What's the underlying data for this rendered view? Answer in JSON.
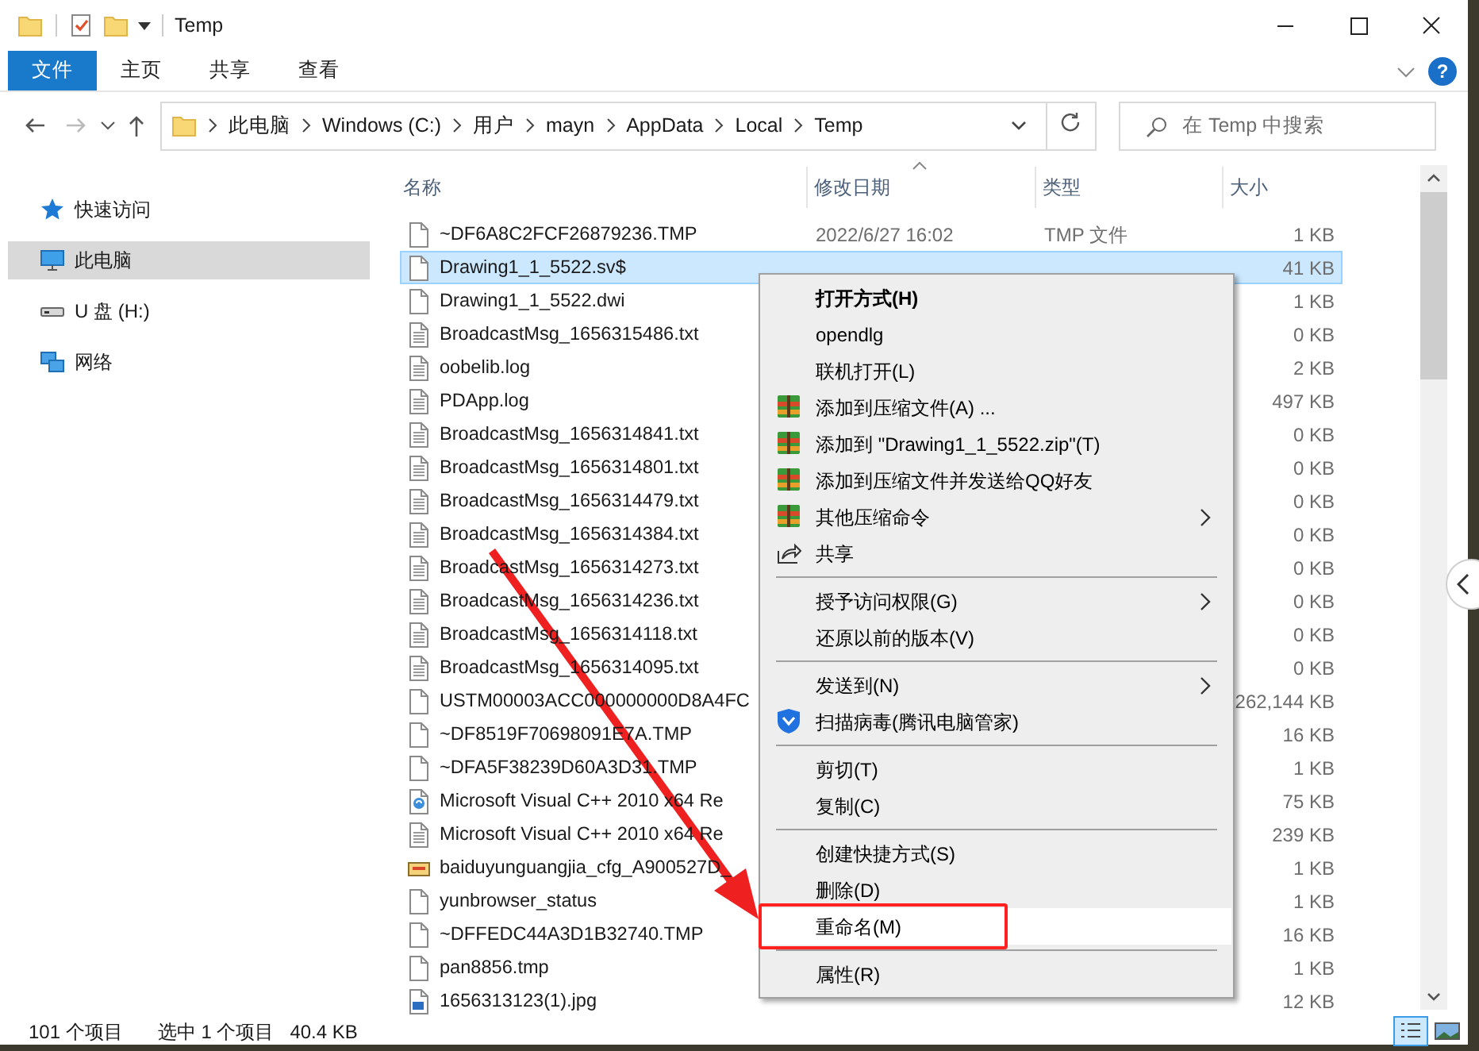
{
  "window": {
    "title": "Temp"
  },
  "ribbon": {
    "tabs": [
      {
        "label": "文件",
        "kind": "file"
      },
      {
        "label": "主页",
        "kind": "tab"
      },
      {
        "label": "共享",
        "kind": "tab"
      },
      {
        "label": "查看",
        "kind": "tab"
      }
    ],
    "help_label": "?"
  },
  "address_bar": {
    "crumbs": [
      "此电脑",
      "Windows (C:)",
      "用户",
      "mayn",
      "AppData",
      "Local",
      "Temp"
    ],
    "search_placeholder": "在 Temp 中搜索"
  },
  "nav_pane": {
    "items": [
      {
        "label": "快速访问",
        "kind": "star",
        "selected": false
      },
      {
        "label": "此电脑",
        "kind": "pc",
        "selected": true
      },
      {
        "label": "U 盘 (H:)",
        "kind": "drive",
        "selected": false
      },
      {
        "label": "网络",
        "kind": "network",
        "selected": false
      }
    ]
  },
  "file_list": {
    "columns": [
      {
        "label": "名称",
        "sorted": false
      },
      {
        "label": "修改日期",
        "sorted": true
      },
      {
        "label": "类型",
        "sorted": false
      },
      {
        "label": "大小",
        "sorted": false
      }
    ],
    "rows": [
      {
        "name": "~DF6A8C2FCF26879236.TMP",
        "date": "2022/6/27 16:02",
        "type": "TMP 文件",
        "size": "1 KB",
        "kind": "blank",
        "selected": false
      },
      {
        "name": "Drawing1_1_5522.sv$",
        "size": "41 KB",
        "kind": "blank",
        "selected": true
      },
      {
        "name": "Drawing1_1_5522.dwi",
        "size": "1 KB",
        "kind": "blank",
        "selected": false
      },
      {
        "name": "BroadcastMsg_1656315486.txt",
        "size": "0 KB",
        "kind": "text",
        "selected": false
      },
      {
        "name": "oobelib.log",
        "size": "2 KB",
        "kind": "text",
        "selected": false
      },
      {
        "name": "PDApp.log",
        "size": "497 KB",
        "kind": "text",
        "selected": false
      },
      {
        "name": "BroadcastMsg_1656314841.txt",
        "size": "0 KB",
        "kind": "text",
        "selected": false
      },
      {
        "name": "BroadcastMsg_1656314801.txt",
        "size": "0 KB",
        "kind": "text",
        "selected": false
      },
      {
        "name": "BroadcastMsg_1656314479.txt",
        "size": "0 KB",
        "kind": "text",
        "selected": false
      },
      {
        "name": "BroadcastMsg_1656314384.txt",
        "size": "0 KB",
        "kind": "text",
        "selected": false
      },
      {
        "name": "BroadcastMsg_1656314273.txt",
        "size": "0 KB",
        "kind": "text",
        "selected": false
      },
      {
        "name": "BroadcastMsg_1656314236.txt",
        "size": "0 KB",
        "kind": "text",
        "selected": false
      },
      {
        "name": "BroadcastMsg_1656314118.txt",
        "size": "0 KB",
        "kind": "text",
        "selected": false
      },
      {
        "name": "BroadcastMsg_1656314095.txt",
        "size": "0 KB",
        "kind": "text",
        "selected": false
      },
      {
        "name": "USTM00003ACC000000000D8A4FC",
        "size": "262,144 KB",
        "kind": "blank",
        "selected": false
      },
      {
        "name": "~DF8519F70698091E7A.TMP",
        "size": "16 KB",
        "kind": "blank",
        "selected": false
      },
      {
        "name": "~DFA5F38239D60A3D31.TMP",
        "size": "1 KB",
        "kind": "blank",
        "selected": false
      },
      {
        "name": "Microsoft Visual C++ 2010 x64 Re",
        "size": "75 KB",
        "kind": "setup",
        "selected": false
      },
      {
        "name": "Microsoft Visual C++ 2010 x64 Re",
        "size": "239 KB",
        "kind": "text",
        "selected": false
      },
      {
        "name": "baiduyunguangjia_cfg_A900527D_",
        "size": "1 KB",
        "kind": "config",
        "selected": false
      },
      {
        "name": "yunbrowser_status",
        "size": "1 KB",
        "kind": "blank",
        "selected": false
      },
      {
        "name": "~DFFEDC44A3D1B32740.TMP",
        "size": "16 KB",
        "kind": "blank",
        "selected": false
      },
      {
        "name": "pan8856.tmp",
        "size": "1 KB",
        "kind": "blank",
        "selected": false
      },
      {
        "name": "1656313123(1).jpg",
        "size": "12 KB",
        "kind": "image",
        "selected": false
      }
    ]
  },
  "context_menu": {
    "items": [
      {
        "label": "打开方式(H)",
        "kind": "plain",
        "bold": true,
        "submenu": false,
        "selected": false
      },
      {
        "label": "opendlg",
        "kind": "plain",
        "bold": false,
        "submenu": false,
        "selected": false
      },
      {
        "label": "联机打开(L)",
        "kind": "plain",
        "bold": false,
        "submenu": false,
        "selected": false
      },
      {
        "label": "添加到压缩文件(A) ...",
        "kind": "archive",
        "bold": false,
        "submenu": false,
        "selected": false
      },
      {
        "label": "添加到 \"Drawing1_1_5522.zip\"(T)",
        "kind": "archive",
        "bold": false,
        "submenu": false,
        "selected": false
      },
      {
        "label": "添加到压缩文件并发送给QQ好友",
        "kind": "archive",
        "bold": false,
        "submenu": false,
        "selected": false
      },
      {
        "label": "其他压缩命令",
        "kind": "archive",
        "bold": false,
        "submenu": true,
        "selected": false
      },
      {
        "label": "共享",
        "kind": "share",
        "bold": false,
        "submenu": false,
        "selected": false
      },
      {
        "kind": "separator"
      },
      {
        "label": "授予访问权限(G)",
        "kind": "plain",
        "bold": false,
        "submenu": true,
        "selected": false
      },
      {
        "label": "还原以前的版本(V)",
        "kind": "plain",
        "bold": false,
        "submenu": false,
        "selected": false
      },
      {
        "kind": "separator"
      },
      {
        "label": "发送到(N)",
        "kind": "plain",
        "bold": false,
        "submenu": true,
        "selected": false
      },
      {
        "label": "扫描病毒(腾讯电脑管家)",
        "kind": "shield",
        "bold": false,
        "submenu": false,
        "selected": false
      },
      {
        "kind": "separator"
      },
      {
        "label": "剪切(T)",
        "kind": "plain",
        "bold": false,
        "submenu": false,
        "selected": false
      },
      {
        "label": "复制(C)",
        "kind": "plain",
        "bold": false,
        "submenu": false,
        "selected": false
      },
      {
        "kind": "separator"
      },
      {
        "label": "创建快捷方式(S)",
        "kind": "plain",
        "bold": false,
        "submenu": false,
        "selected": false
      },
      {
        "label": "删除(D)",
        "kind": "plain",
        "bold": false,
        "submenu": false,
        "selected": false
      },
      {
        "label": "重命名(M)",
        "kind": "plain",
        "bold": false,
        "submenu": false,
        "selected": true
      },
      {
        "kind": "separator"
      },
      {
        "label": "属性(R)",
        "kind": "plain",
        "bold": false,
        "submenu": false,
        "selected": false
      }
    ]
  },
  "status_bar": {
    "item_count": "101 个项目",
    "selection": "选中 1 个项目",
    "selection_size": "40.4 KB",
    "views": [
      {
        "kind": "details",
        "selected": true
      },
      {
        "kind": "large_icons",
        "selected": false
      }
    ]
  }
}
